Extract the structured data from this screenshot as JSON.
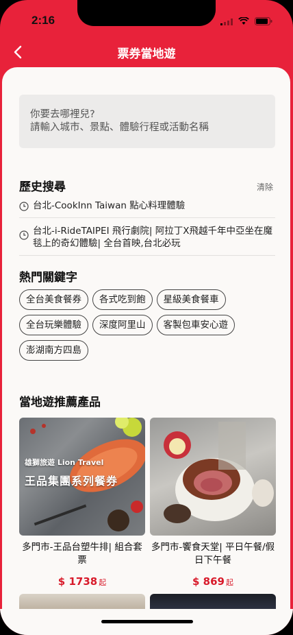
{
  "status": {
    "time": "2:16"
  },
  "nav": {
    "title": "票券當地遊"
  },
  "search": {
    "line1": "你要去哪裡兒?",
    "line2": "請輸入城市、景點、體驗行程或活動名稱"
  },
  "history": {
    "title": "歷史搜尋",
    "clear_label": "清除",
    "items": [
      {
        "text": "台北-CookInn Taiwan 點心料理體驗"
      },
      {
        "text": "台北-i-RideTAIPEI 飛行劇院| 阿拉丁X飛越千年中亞坐在魔毯上的奇幻體驗| 全台首映,台北必玩"
      }
    ]
  },
  "keywords": {
    "title": "熱門關鍵字",
    "items": [
      "全台美食餐券",
      "各式吃到飽",
      "星級美食餐車",
      "全台玩樂體驗",
      "深度阿里山",
      "客製包車安心遊",
      "澎湖南方四島"
    ]
  },
  "recommend": {
    "title": "當地遊推薦產品",
    "products": [
      {
        "name": "多門市-王品台塑牛排| 組合套票",
        "price": "$ 1738",
        "price_suffix": "起",
        "banner_line1": "雄獅旅遊 Lion Travel",
        "banner_line2": "王品集團系列餐券"
      },
      {
        "name": "多門市-饗食天堂| 平日午餐/假日下午餐",
        "price": "$ 869",
        "price_suffix": "起"
      }
    ]
  },
  "colors": {
    "brand": "#e8223a",
    "price": "#d81a2a"
  }
}
